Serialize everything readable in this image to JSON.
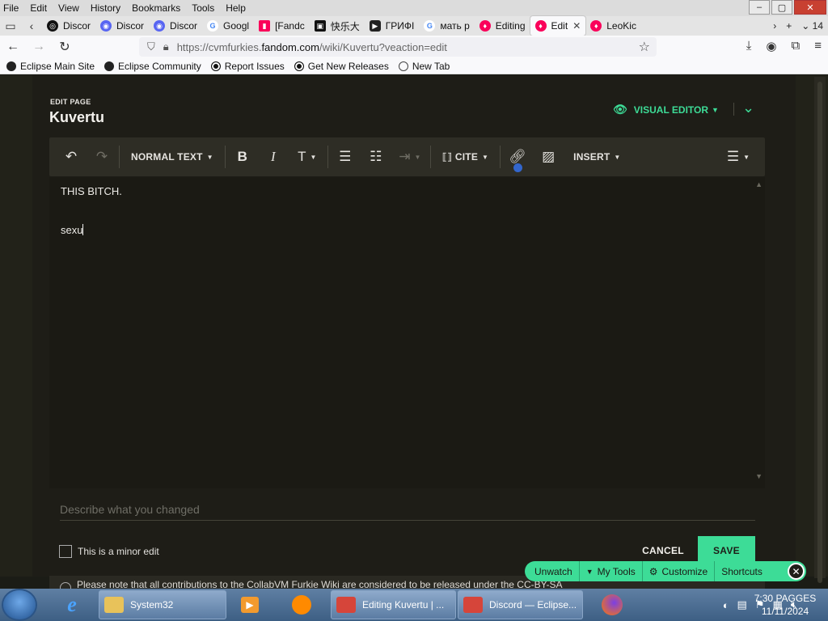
{
  "browser": {
    "menu": [
      "File",
      "Edit",
      "View",
      "History",
      "Bookmarks",
      "Tools",
      "Help"
    ],
    "tabs": [
      {
        "label": "Discor",
        "color": "#111111",
        "glyph": "◎"
      },
      {
        "label": "Discor",
        "color": "#5865f2",
        "glyph": "◉"
      },
      {
        "label": "Discor",
        "color": "#5865f2",
        "glyph": "◉"
      },
      {
        "label": "Googl",
        "color": "#ffffff",
        "glyph": "G"
      },
      {
        "label": "[Fandc",
        "color": "#fa005a",
        "glyph": "▮"
      },
      {
        "label": "快乐大",
        "color": "#111111",
        "glyph": "▣"
      },
      {
        "label": "ГРИФІ",
        "color": "#222222",
        "glyph": "▶"
      },
      {
        "label": "мать р",
        "color": "#ffffff",
        "glyph": "G"
      },
      {
        "label": "Editing",
        "color": "#fa005a",
        "glyph": "♦"
      },
      {
        "label": "Edit",
        "color": "#fa005a",
        "glyph": "♦"
      },
      {
        "label": "LeoKic",
        "color": "#fa005a",
        "glyph": "♦"
      }
    ],
    "tab_count": "14",
    "url_prefix": "https://cvmfurkies.",
    "url_domain": "fandom.com",
    "url_path": "/wiki/Kuvertu?veaction=edit",
    "bookmarks": [
      "Eclipse Main Site",
      "Eclipse Community",
      "Report Issues",
      "Get New Releases",
      "New Tab"
    ]
  },
  "editor": {
    "edit_page_label": "EDIT PAGE",
    "page_title": "Kuvertu",
    "mode_label": "VISUAL EDITOR",
    "toolbar": {
      "paragraph_format": "NORMAL TEXT",
      "cite": "CITE",
      "insert": "INSERT"
    },
    "content": {
      "line1": "THIS BITCH.",
      "line2": "sexu"
    },
    "summary_placeholder": "Describe what you changed",
    "minor_edit_label": "This is a minor edit",
    "cancel_label": "CANCEL",
    "save_label": "SAVE",
    "notice_text": "Please note that all contributions to the CollabVM Furkie Wiki are considered to be released under the CC-BY-SA"
  },
  "tools_bar": {
    "unwatch": "Unwatch",
    "my_tools": "My Tools",
    "customize": "Customize",
    "shortcuts": "Shortcuts"
  },
  "taskbar": {
    "tasks": [
      {
        "label": "System32"
      },
      {
        "label": "Editing Kuvertu | ..."
      },
      {
        "label": "Discord — Eclipse..."
      }
    ],
    "clock_time": "7:30 PAGGES",
    "clock_date": "11/11/2024"
  },
  "colors": {
    "accent": "#3ddc97",
    "page_bg": "#1e1d17",
    "toolbar_bg": "#2e2d25"
  }
}
